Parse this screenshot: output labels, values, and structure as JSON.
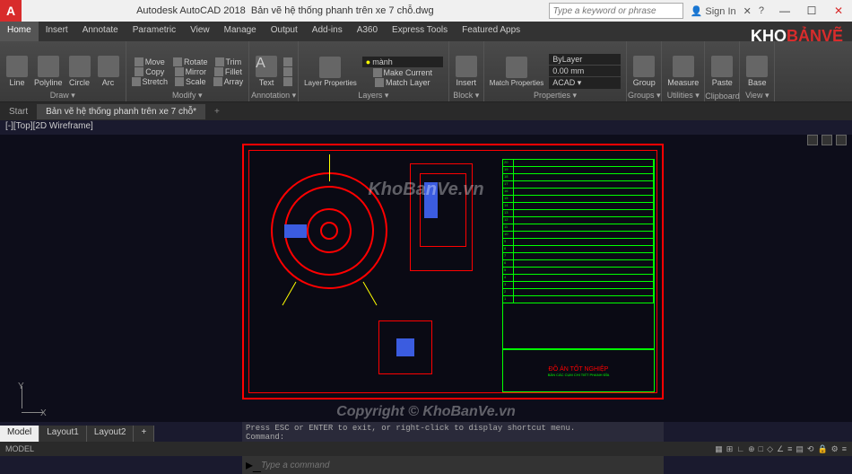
{
  "title": {
    "app": "Autodesk AutoCAD 2018",
    "file": "Bản vẽ hệ thống phanh trên xe 7 chỗ.dwg",
    "search_ph": "Type a keyword or phrase",
    "signin": "Sign In"
  },
  "ribbon_tabs": [
    "Home",
    "Insert",
    "Annotate",
    "Parametric",
    "View",
    "Manage",
    "Output",
    "Add-ins",
    "A360",
    "Express Tools",
    "Featured Apps"
  ],
  "ribbon": {
    "draw": {
      "label": "Draw ▾",
      "line": "Line",
      "polyline": "Polyline",
      "circle": "Circle",
      "arc": "Arc"
    },
    "modify": {
      "label": "Modify ▾",
      "move": "Move",
      "rotate": "Rotate",
      "trim": "Trim",
      "copy": "Copy",
      "mirror": "Mirror",
      "fillet": "Fillet",
      "stretch": "Stretch",
      "scale": "Scale",
      "array": "Array"
    },
    "annotation": {
      "label": "Annotation ▾",
      "text": "Text"
    },
    "layers": {
      "label": "Layers ▾",
      "props": "Layer Properties",
      "current": "mành",
      "make_current": "Make Current",
      "match": "Match Layer"
    },
    "block": {
      "label": "Block ▾",
      "insert": "Insert"
    },
    "properties": {
      "label": "Properties ▾",
      "match": "Match Properties",
      "layer": "ByLayer",
      "lw": "0.00 mm",
      "acad": "ACAD ▾"
    },
    "groups": {
      "label": "Groups ▾",
      "group": "Group"
    },
    "utilities": {
      "label": "Utilities ▾",
      "measure": "Measure"
    },
    "clipboard": {
      "label": "Clipboard",
      "paste": "Paste"
    },
    "view": {
      "label": "View ▾",
      "base": "Base"
    }
  },
  "doc_tabs": {
    "start": "Start",
    "active": "Bản vẽ hệ thống phanh trên xe 7 chỗ*"
  },
  "view_label": "[-][Top][2D Wireframe]",
  "drawing": {
    "title_block": "ĐỒ ÁN TỐT NGHIỆP",
    "subtitle": "BẢN CÁC CỤM CHI TIẾT PHANH ĐĨA"
  },
  "command": {
    "line1": "Press ESC or ENTER to exit, or right-click to display shortcut menu.",
    "line2": "Command:",
    "line3": "Press ESC or ENTER to exit, or right-click to display shortcut menu.",
    "prompt_ph": "Type a command"
  },
  "layout_tabs": [
    "Model",
    "Layout1",
    "Layout2"
  ],
  "status": {
    "mode": "MODEL"
  },
  "logo": {
    "p1": "KHO",
    "p2": "BẢNVẼ"
  },
  "watermark": {
    "center": "KhoBanVe.vn",
    "bottom": "Copyright © KhoBanVe.vn"
  },
  "ucs": {
    "x": "X",
    "y": "Y"
  }
}
